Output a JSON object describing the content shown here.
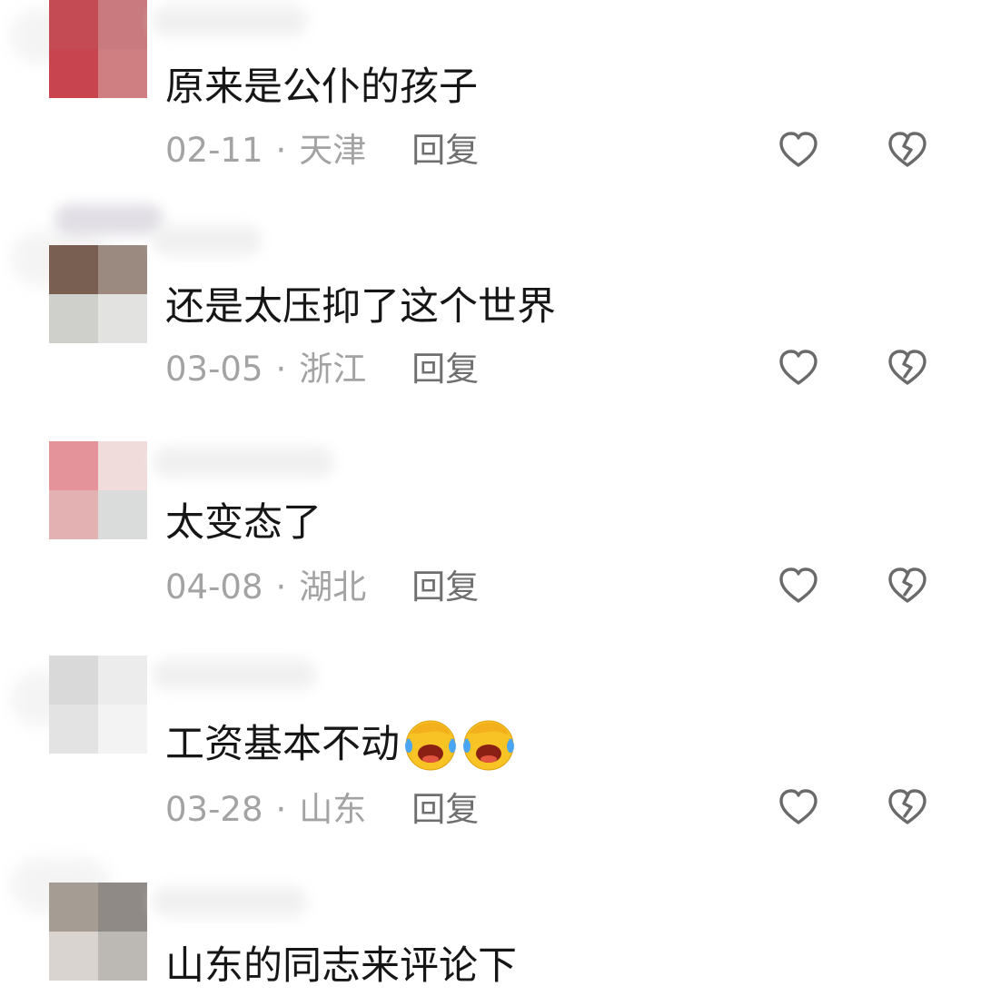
{
  "comments": [
    {
      "text": "原来是公仆的孩子",
      "date": "02-11",
      "separator": "·",
      "location": "天津",
      "reply_label": "回复",
      "avatar_colors": [
        "#c44a53",
        "#c87a7e",
        "#c8444e",
        "#cf7f82"
      ],
      "like_icon": "heart-outline-icon",
      "dislike_icon": "broken-heart-icon"
    },
    {
      "text": "还是太压抑了这个世界",
      "date": "03-05",
      "separator": "·",
      "location": "浙江",
      "reply_label": "回复",
      "avatar_colors": [
        "#785f52",
        "#9a8a80",
        "#cfcfcc",
        "#e2e2e0"
      ],
      "like_icon": "heart-outline-icon",
      "dislike_icon": "broken-heart-icon"
    },
    {
      "text": "太变态了",
      "date": "04-08",
      "separator": "·",
      "location": "湖北",
      "reply_label": "回复",
      "avatar_colors": [
        "#e5939a",
        "#f1dcdc",
        "#e3b1b2",
        "#d9dcdb"
      ],
      "like_icon": "heart-outline-icon",
      "dislike_icon": "broken-heart-icon"
    },
    {
      "text": "工资基本不动",
      "emoji_count": 2,
      "emoji_icon": "facepalm-laughing-emoji",
      "date": "03-28",
      "separator": "·",
      "location": "山东",
      "reply_label": "回复",
      "avatar_colors": [
        "#d9d9d9",
        "#ececec",
        "#e3e3e3",
        "#f3f3f3"
      ],
      "like_icon": "heart-outline-icon",
      "dislike_icon": "broken-heart-icon"
    },
    {
      "text": "山东的同志来评论下",
      "avatar_colors": [
        "#a59c94",
        "#8f8a86",
        "#d9d4cf",
        "#bcb8b4"
      ]
    }
  ],
  "colors": {
    "text": "#161616",
    "meta": "#a3a3a3",
    "reply": "#6f6f6f",
    "icon": "#6a6a6a"
  }
}
